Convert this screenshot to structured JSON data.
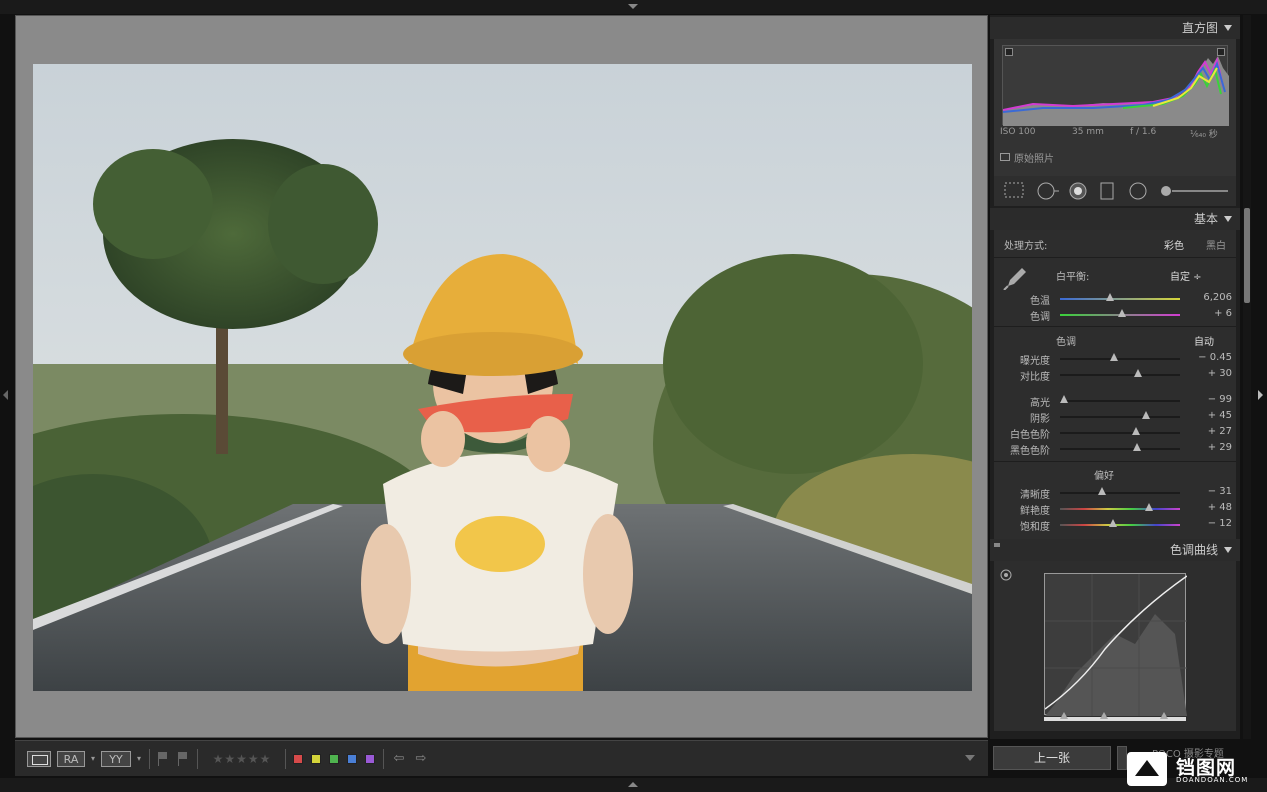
{
  "panel": {
    "histogram_title": "直方图",
    "exif": {
      "iso": "ISO 100",
      "focal": "35 mm",
      "aperture": "f / 1.6",
      "shutter": "¹⁄₆₄₀ 秒"
    },
    "original_photo_label": "原始照片",
    "basic_title": "基本",
    "treatment_label": "处理方式:",
    "treatment_color": "彩色",
    "treatment_bw": "黑白",
    "wb_label": "白平衡:",
    "wb_value": "自定 ÷",
    "tone_title": "色调",
    "tone_auto": "自动",
    "presence_title": "偏好",
    "curve_title": "色调曲线"
  },
  "sliders": {
    "temp": {
      "label": "色温",
      "value": "6,206",
      "position": 0.42
    },
    "tint": {
      "label": "色调",
      "value": "+ 6",
      "position": 0.52
    },
    "exposure": {
      "label": "曝光度",
      "value": "− 0.45",
      "position": 0.45
    },
    "contrast": {
      "label": "对比度",
      "value": "+ 30",
      "position": 0.65
    },
    "highlights": {
      "label": "高光",
      "value": "− 99",
      "position": 0.03
    },
    "shadows": {
      "label": "阴影",
      "value": "+ 45",
      "position": 0.72
    },
    "whites": {
      "label": "白色色阶",
      "value": "+ 27",
      "position": 0.63
    },
    "blacks": {
      "label": "黑色色阶",
      "value": "+ 29",
      "position": 0.64
    },
    "clarity": {
      "label": "清晰度",
      "value": "− 31",
      "position": 0.35
    },
    "vibrance": {
      "label": "鲜艳度",
      "value": "+ 48",
      "position": 0.74
    },
    "saturation": {
      "label": "饱和度",
      "value": "− 12",
      "position": 0.44
    }
  },
  "toolbar": {
    "ra_label": "RA",
    "yy_label": "YY",
    "stars": "★★★★★",
    "color_labels": [
      "#d64a4a",
      "#d4d43a",
      "#4fb34f",
      "#4a7fd6",
      "#9a5ad6"
    ]
  },
  "footer": {
    "prev_button": "上一张"
  },
  "watermark": {
    "text": "铛图网",
    "sub": "DOANDOAN.COM",
    "poco": "POCO 摄影专题"
  }
}
